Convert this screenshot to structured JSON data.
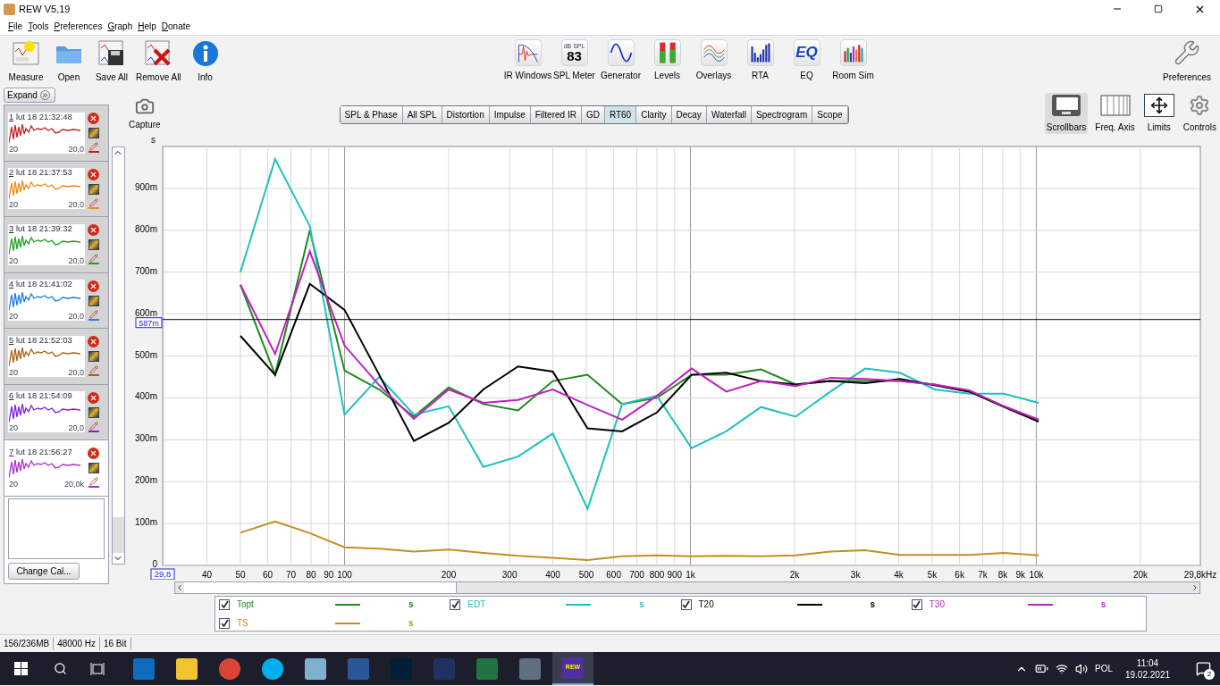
{
  "window": {
    "title": "REW V5,19"
  },
  "menu": [
    "File",
    "Tools",
    "Preferences",
    "Graph",
    "Help",
    "Donate"
  ],
  "toolbar_left": [
    {
      "kind": "measure",
      "label": "Measure"
    },
    {
      "kind": "open",
      "label": "Open"
    },
    {
      "kind": "save_all",
      "label": "Save All"
    },
    {
      "kind": "remove_all",
      "label": "Remove All"
    },
    {
      "kind": "info",
      "label": "Info"
    }
  ],
  "toolbar_center": [
    {
      "kind": "ir_windows",
      "label": "IR Windows"
    },
    {
      "kind": "spl_meter",
      "label": "SPL Meter",
      "icon_text": [
        "dB SPL",
        "83"
      ]
    },
    {
      "kind": "generator",
      "label": "Generator"
    },
    {
      "kind": "levels",
      "label": "Levels"
    },
    {
      "kind": "overlays",
      "label": "Overlays"
    },
    {
      "kind": "rta",
      "label": "RTA"
    },
    {
      "kind": "eq",
      "label": "EQ",
      "icon_text": [
        "EQ"
      ]
    },
    {
      "kind": "room_sim",
      "label": "Room Sim"
    }
  ],
  "toolbar_right": [
    {
      "kind": "preferences",
      "label": "Preferences"
    }
  ],
  "side_panel": {
    "expand": "Expand",
    "change_cal": "Change Cal..."
  },
  "measurements": [
    {
      "number": "1",
      "name": "lut 18 21:32:48",
      "axis_min": "20",
      "axis_max": "20,0",
      "color": "#c42020",
      "selected": false
    },
    {
      "number": "2",
      "name": "lut 18 21:37:53",
      "axis_min": "20",
      "axis_max": "20,0",
      "color": "#f08a10",
      "selected": false
    },
    {
      "number": "3",
      "name": "lut 18 21:39:32",
      "axis_min": "20",
      "axis_max": "20,0",
      "color": "#20a020",
      "selected": false
    },
    {
      "number": "4",
      "name": "lut 18 21:41:02",
      "axis_min": "20",
      "axis_max": "20,0",
      "color": "#2080e0",
      "selected": false
    },
    {
      "number": "5",
      "name": "lut 18 21:52:03",
      "axis_min": "20",
      "axis_max": "20,0",
      "color": "#b06010",
      "selected": false
    },
    {
      "number": "6",
      "name": "lut 18 21:54:09",
      "axis_min": "20",
      "axis_max": "20,0",
      "color": "#8020f0",
      "selected": false
    },
    {
      "number": "7",
      "name": "lut 18 21:56:27",
      "axis_min": "20",
      "axis_max": "20,0k",
      "color": "#b030d0",
      "selected": true
    }
  ],
  "capture": {
    "label": "Capture"
  },
  "graph_tabs": [
    {
      "label": "SPL & Phase",
      "selected": false
    },
    {
      "label": "All SPL",
      "selected": false
    },
    {
      "label": "Distortion",
      "selected": false
    },
    {
      "label": "Impulse",
      "selected": false
    },
    {
      "label": "Filtered IR",
      "selected": false
    },
    {
      "label": "GD",
      "selected": false
    },
    {
      "label": "RT60",
      "selected": true
    },
    {
      "label": "Clarity",
      "selected": false
    },
    {
      "label": "Decay",
      "selected": false
    },
    {
      "label": "Waterfall",
      "selected": false
    },
    {
      "label": "Spectrogram",
      "selected": false
    },
    {
      "label": "Scope",
      "selected": false
    }
  ],
  "graph_controls": [
    {
      "kind": "scrollbars",
      "label": "Scrollbars",
      "selected": true
    },
    {
      "kind": "freq_axis",
      "label": "Freq. Axis",
      "selected": false
    },
    {
      "kind": "limits",
      "label": "Limits",
      "selected": false
    },
    {
      "kind": "controls",
      "label": "Controls",
      "selected": false
    }
  ],
  "graph": {
    "cursor": {
      "x_label": "29,8"
    },
    "x_axis_end_label": "29,8kHz",
    "x_axis_labels": [
      "40",
      "50",
      "60",
      "70",
      "80",
      "90",
      "100",
      "200",
      "300",
      "400",
      "500",
      "600",
      "700",
      "800",
      "900",
      "1k",
      "2k",
      "3k",
      "4k",
      "5k",
      "6k",
      "7k",
      "8k",
      "9k",
      "10k",
      "20k"
    ],
    "chart_data": {
      "type": "line",
      "ylabel": "s",
      "grid": true,
      "ref_lines": [
        {
          "axis": "y",
          "value": 587,
          "label": "587m"
        }
      ],
      "categories": [
        null,
        null,
        null,
        null,
        null,
        null,
        null,
        null,
        null,
        null,
        null,
        null,
        null,
        null,
        null,
        null,
        null,
        null,
        null,
        null,
        null,
        null,
        null,
        null
      ],
      "series": [
        {
          "name": "Topt",
          "color": "#1e8a1e",
          "values": [
            670,
            455,
            800,
            465,
            420,
            355,
            425,
            385,
            370,
            440,
            455,
            385,
            400,
            455,
            455,
            468,
            432,
            440,
            440,
            440,
            432,
            415,
            380,
            345
          ]
        },
        {
          "name": "EDT",
          "color": "#20c0c0",
          "values": [
            700,
            970,
            810,
            360,
            450,
            360,
            380,
            235,
            260,
            315,
            135,
            385,
            405,
            280,
            320,
            378,
            355,
            415,
            470,
            460,
            420,
            410,
            410,
            388
          ]
        },
        {
          "name": "T20",
          "color": "#000000",
          "values": [
            548,
            455,
            672,
            610,
            455,
            297,
            340,
            420,
            475,
            463,
            327,
            320,
            365,
            455,
            460,
            440,
            432,
            440,
            435,
            445,
            430,
            415,
            378,
            343
          ]
        },
        {
          "name": "T30",
          "color": "#c020c0",
          "values": [
            670,
            505,
            750,
            525,
            430,
            350,
            420,
            388,
            395,
            420,
            383,
            348,
            405,
            470,
            415,
            440,
            428,
            448,
            445,
            440,
            432,
            418,
            380,
            348
          ]
        },
        {
          "name": "TS",
          "color": "#c09020",
          "values": [
            78,
            105,
            77,
            43,
            40,
            33,
            38,
            30,
            23,
            18,
            13,
            22,
            24,
            22,
            23,
            22,
            24,
            33,
            36,
            25,
            25,
            25,
            30,
            24
          ]
        }
      ],
      "ylim": [
        0,
        1000
      ],
      "yticks": [
        {
          "value": 0,
          "label": "0"
        },
        {
          "value": 100,
          "label": "100m"
        },
        {
          "value": 200,
          "label": "200m"
        },
        {
          "value": 300,
          "label": "300m"
        },
        {
          "value": 400,
          "label": "400m"
        },
        {
          "value": 500,
          "label": "500m"
        },
        {
          "value": 600,
          "label": "600m"
        },
        {
          "value": 700,
          "label": "700m"
        },
        {
          "value": 800,
          "label": "800m"
        },
        {
          "value": 900,
          "label": "900m"
        }
      ]
    }
  },
  "legend": [
    {
      "checked": true,
      "unit": "s"
    },
    {
      "checked": true,
      "unit": "s"
    },
    {
      "checked": true,
      "unit": "s"
    },
    {
      "checked": true,
      "unit": "s"
    },
    {
      "checked": true,
      "unit": "s"
    }
  ],
  "status_bar": [
    "156/236MB",
    "48000 Hz",
    "16 Bit"
  ],
  "taskbar": {
    "apps": [
      {
        "kind": "outlook",
        "active": false
      },
      {
        "kind": "explorer",
        "active": false
      },
      {
        "kind": "chrome",
        "active": false
      },
      {
        "kind": "skype",
        "active": false
      },
      {
        "kind": "notepad",
        "active": false
      },
      {
        "kind": "word",
        "active": false
      },
      {
        "kind": "photoshop",
        "active": false
      },
      {
        "kind": "floppy",
        "active": false
      },
      {
        "kind": "excel",
        "active": false
      },
      {
        "kind": "calculator",
        "active": false
      },
      {
        "kind": "rew",
        "active": true,
        "icon_text": "REW"
      }
    ],
    "language": "POL",
    "time": "11:04",
    "date": "19.02.2021",
    "notifications": "2"
  }
}
